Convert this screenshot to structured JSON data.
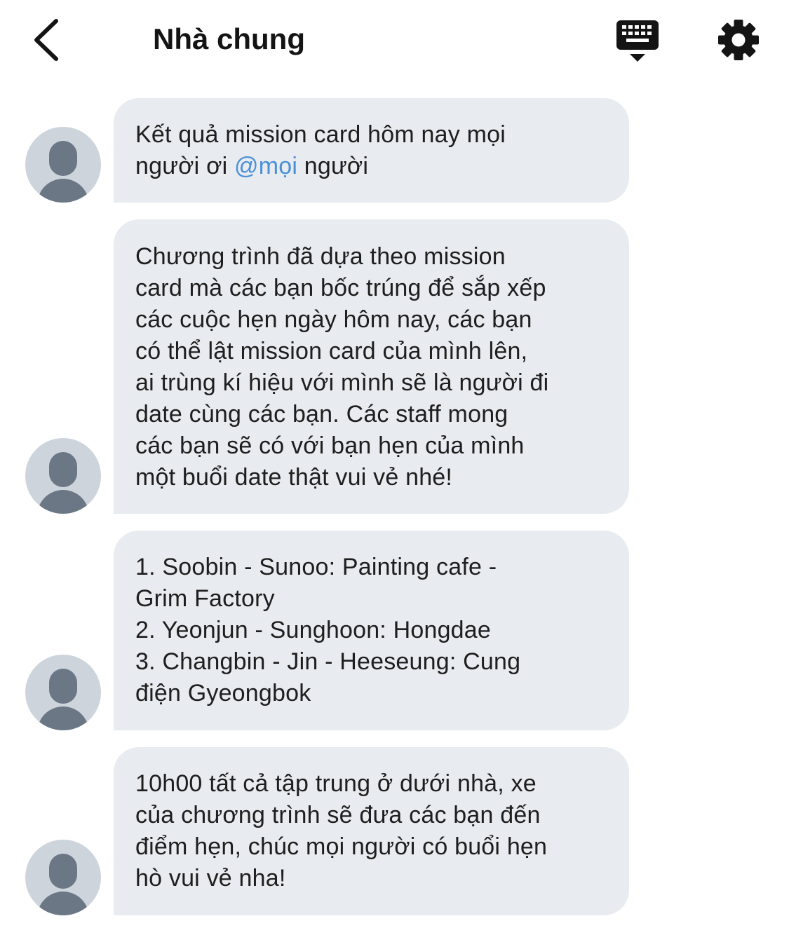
{
  "header": {
    "title": "Nhà chung",
    "back_icon": "chevron-left-icon",
    "keyboard_icon": "keyboard-icon",
    "settings_icon": "gear-icon"
  },
  "colors": {
    "bubble_bg": "#e8ebef",
    "mention": "#4a90d9",
    "avatar_bg": "#cdd4db",
    "avatar_fg": "#6b7785"
  },
  "messages": [
    {
      "text_before": "Kết quả mission card hôm nay mọi\nngười ơi ",
      "mention": "@mọi",
      "text_after": " người"
    },
    {
      "text": "Chương trình đã dựa theo mission\ncard mà các bạn bốc trúng để sắp xếp\ncác cuộc hẹn ngày hôm nay, các bạn\ncó thể lật mission card của mình lên,\nai trùng kí hiệu với mình sẽ là người đi\ndate cùng các bạn. Các staff mong\ncác bạn sẽ có với bạn hẹn của mình\nmột buổi date thật vui vẻ nhé!"
    },
    {
      "text": "1. Soobin - Sunoo: Painting cafe -\nGrim Factory\n2. Yeonjun - Sunghoon: Hongdae\n3. Changbin - Jin - Heeseung: Cung\nđiện Gyeongbok"
    },
    {
      "text": "10h00 tất cả tập trung ở dưới nhà, xe\ncủa chương trình sẽ đưa các bạn đến\nđiểm hẹn, chúc mọi người có buổi hẹn\nhò vui vẻ nha!"
    }
  ]
}
